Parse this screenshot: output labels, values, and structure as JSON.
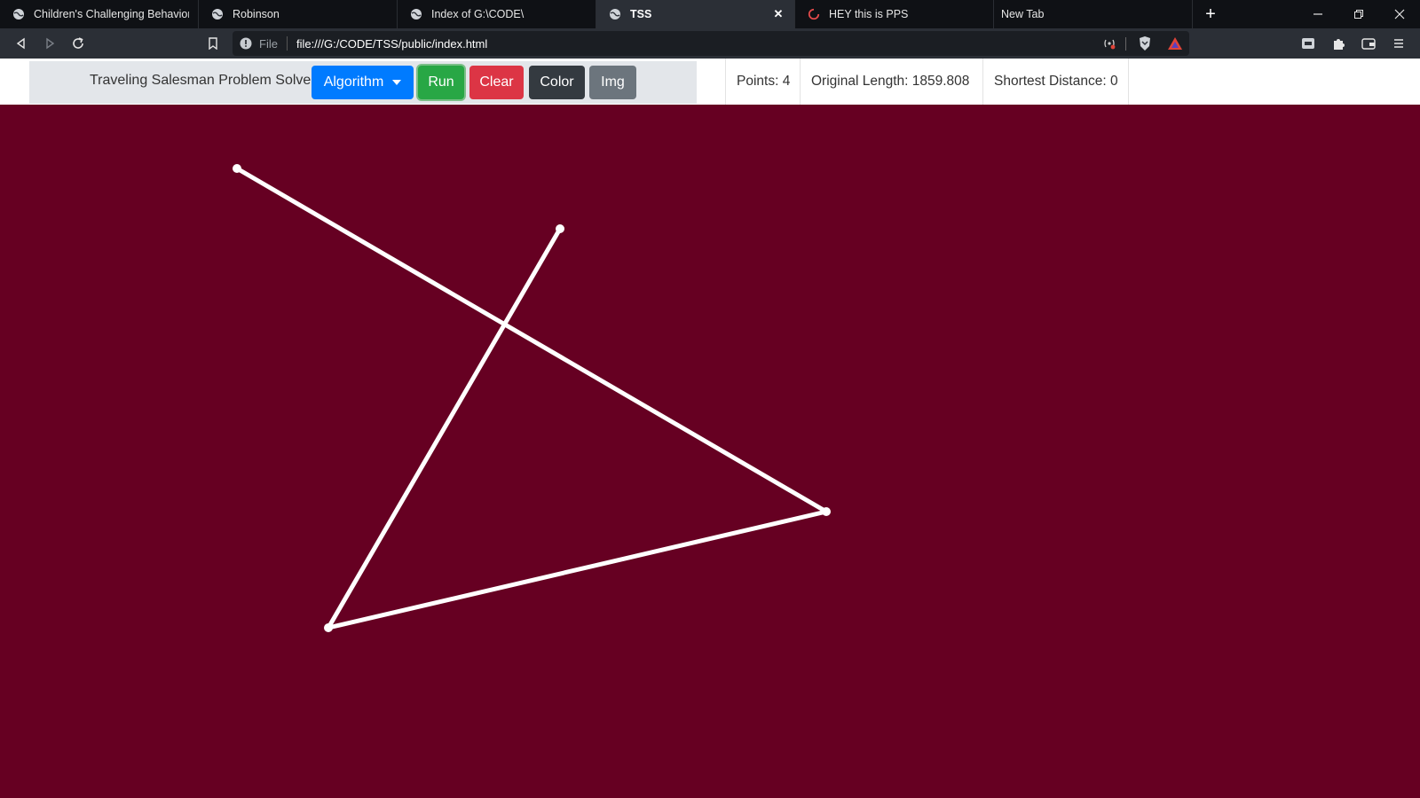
{
  "tabs": [
    {
      "title": "Children's Challenging Behaviors",
      "icon": "globe-icon"
    },
    {
      "title": "Robinson",
      "icon": "globe-icon"
    },
    {
      "title": "Index of G:\\CODE\\",
      "icon": "globe-icon"
    },
    {
      "title": "TSS",
      "icon": "globe-icon",
      "active": true
    },
    {
      "title": "HEY this is PPS",
      "icon": "loading-spinner-icon"
    },
    {
      "title": "New Tab",
      "icon": ""
    }
  ],
  "address_bar": {
    "scheme_label": "File",
    "url": "file:///G:/CODE/TSS/public/index.html"
  },
  "app": {
    "title": "Traveling Salesman Problem Solver",
    "buttons": {
      "algorithm": "Algorithm",
      "run": "Run",
      "clear": "Clear",
      "color": "Color",
      "img": "Img"
    },
    "stats": {
      "points": "Points: 4",
      "original_length": "Original Length: 1859.808",
      "shortest_distance": "Shortest Distance: 0"
    }
  },
  "colors": {
    "canvas_background": "#660022",
    "path_color": "#ffffff",
    "algorithm_button": "#007bff",
    "run_button": "#28a745",
    "clear_button": "#dc3545",
    "color_button": "#343a40",
    "img_button": "#6c757d"
  }
}
